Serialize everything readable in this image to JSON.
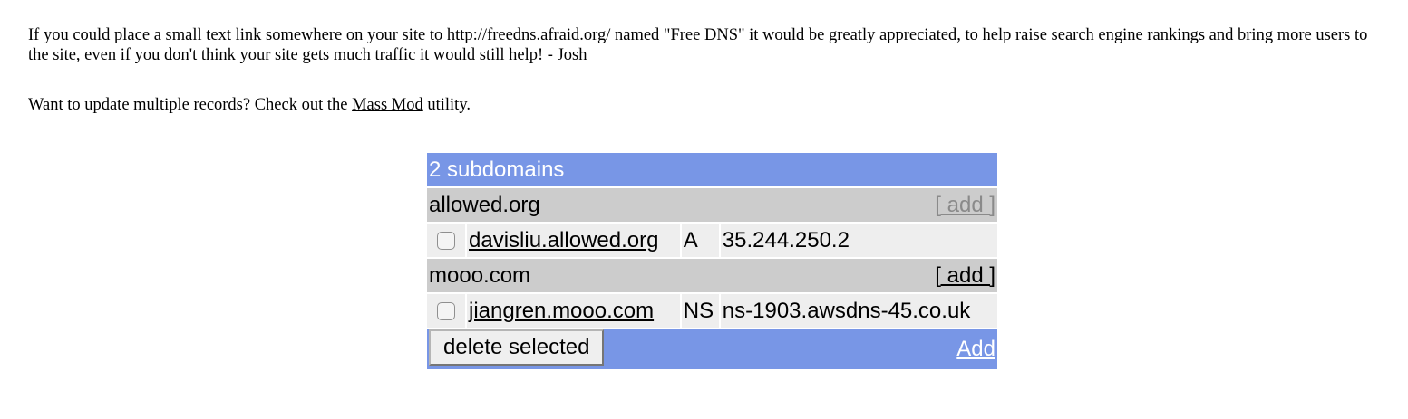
{
  "intro": {
    "text": "If you could place a small text link somewhere on your site to http://freedns.afraid.org/ named \"Free DNS\" it would be greatly appreciated, to help raise search engine rankings and bring more users to the site, even if you don't think your site gets much traffic it would still help! - Josh"
  },
  "mass_mod": {
    "prefix": "Want to update multiple records? Check out the",
    "link": "Mass Mod",
    "suffix": " utility."
  },
  "table": {
    "title": "2 subdomains",
    "groups": [
      {
        "domain": "allowed.org",
        "add_label": "[ add ]",
        "records": [
          {
            "host": "davisliu.allowed.org",
            "type": "A",
            "value": "35.244.250.2"
          }
        ]
      },
      {
        "domain": "mooo.com",
        "add_label": "[ add ]",
        "records": [
          {
            "host": "jiangren.mooo.com",
            "type": "NS",
            "value": "ns-1903.awsdns-45.co.uk"
          }
        ]
      }
    ],
    "delete_label": "delete selected",
    "add_label": "Add"
  },
  "colors": {
    "header_bg": "#7896e6",
    "domain_bg": "#cccccc",
    "record_bg": "#eeeeee"
  }
}
